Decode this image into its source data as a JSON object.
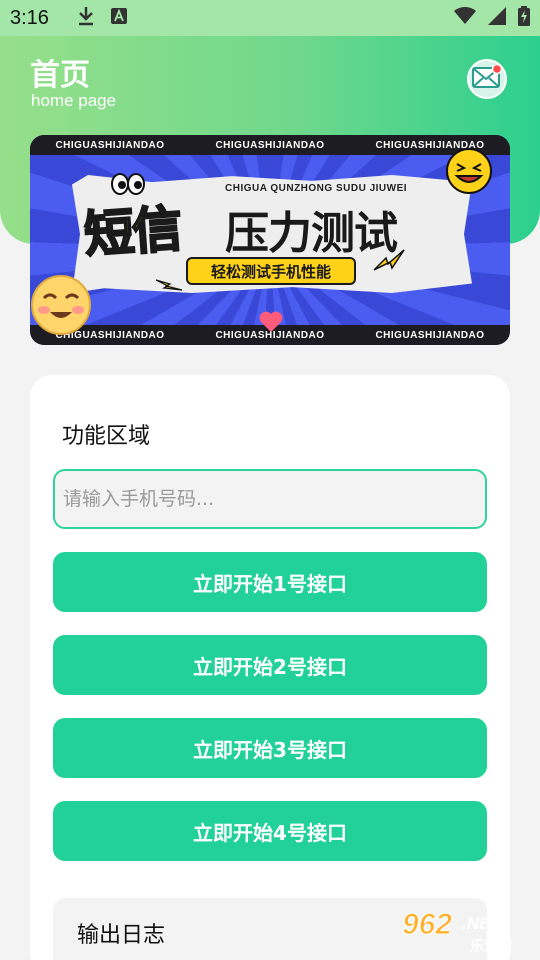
{
  "status_bar": {
    "time": "3:16",
    "icons": [
      "download-icon",
      "text-a-icon",
      "wifi-icon",
      "signal-icon",
      "battery-charging-icon"
    ]
  },
  "header": {
    "title": "首页",
    "subtitle": "home page",
    "mail_icon": "mail-icon",
    "mail_badge_color": "#ff4b4b"
  },
  "banner": {
    "strip_text": "CHIGUASHIJIANDAO",
    "sub_text": "CHIGUA QUNZHONG SUDU JIUWEI",
    "big_yellow": "短信",
    "big_black": "压力测试",
    "pill_text": "轻松测试手机性能"
  },
  "function_area": {
    "title": "功能区域",
    "phone_input": {
      "value": "",
      "placeholder": "请输入手机号码..."
    },
    "buttons": [
      {
        "label": "立即开始1号接口"
      },
      {
        "label": "立即开始2号接口"
      },
      {
        "label": "立即开始3号接口"
      },
      {
        "label": "立即开始4号接口"
      }
    ],
    "log_title": "输出日志"
  },
  "watermark": {
    "number": "962",
    "suffix": ".NET",
    "cn": "乐游网"
  },
  "colors": {
    "accent": "#22d197",
    "header_start": "#96df8a",
    "header_end": "#2ccf8e",
    "banner_yellow": "#ffd21a",
    "banner_blue": "#4b5cf0"
  }
}
